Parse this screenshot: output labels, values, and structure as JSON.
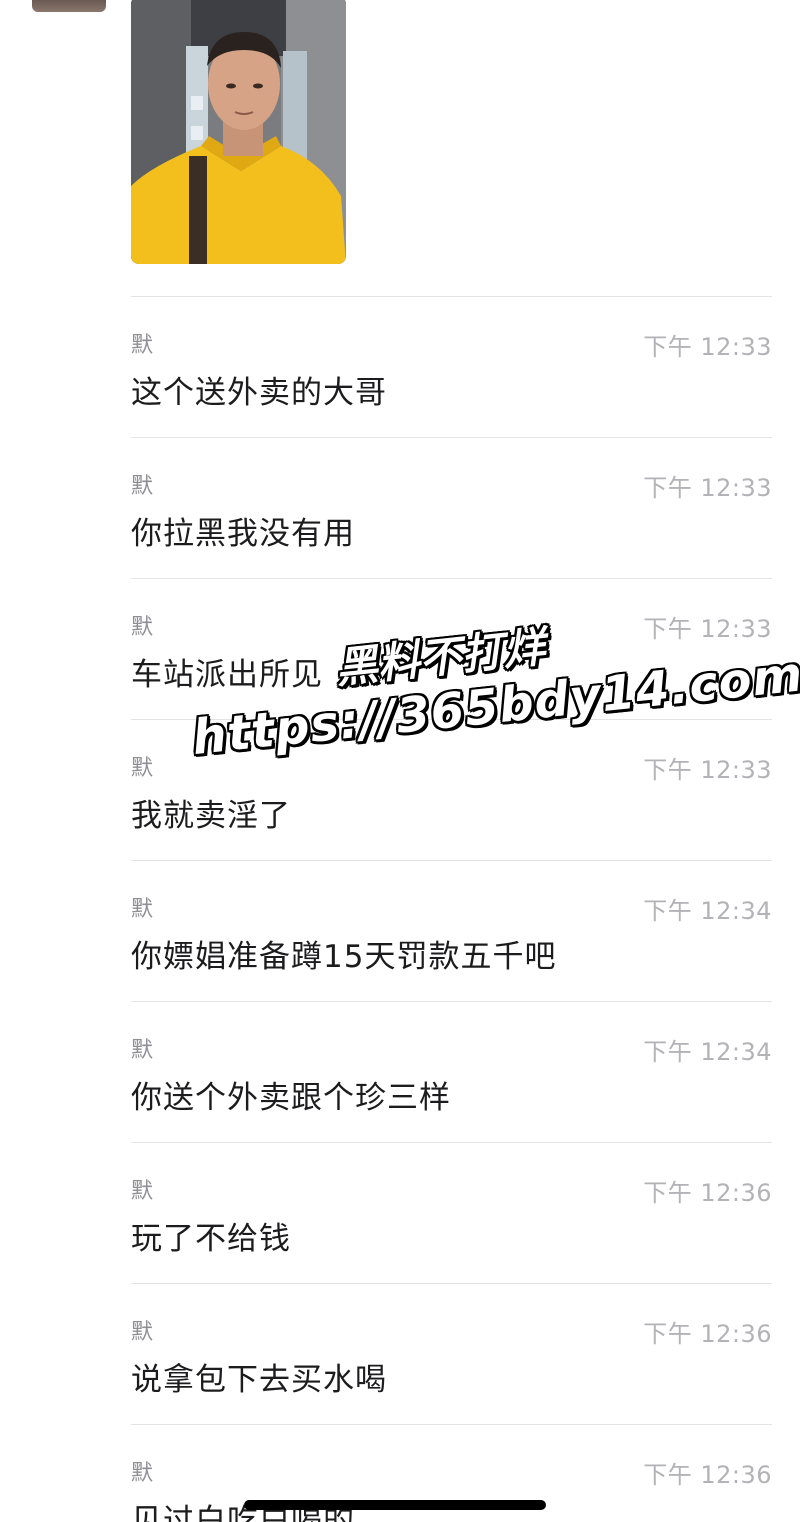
{
  "attachment": {
    "type": "photo",
    "icon": "selfie-photo"
  },
  "messages": [
    {
      "sender": "默",
      "time": "下午 12:33",
      "text": "这个送外卖的大哥"
    },
    {
      "sender": "默",
      "time": "下午 12:33",
      "text": "你拉黑我没有用"
    },
    {
      "sender": "默",
      "time": "下午 12:33",
      "text": "车站派出所见"
    },
    {
      "sender": "默",
      "time": "下午 12:33",
      "text": "我就卖淫了"
    },
    {
      "sender": "默",
      "time": "下午 12:34",
      "text": "你嫖娼准备蹲15天罚款五千吧"
    },
    {
      "sender": "默",
      "time": "下午 12:34",
      "text": "你送个外卖跟个珍三样"
    },
    {
      "sender": "默",
      "time": "下午 12:36",
      "text": "玩了不给钱"
    },
    {
      "sender": "默",
      "time": "下午 12:36",
      "text": "说拿包下去买水喝"
    },
    {
      "sender": "默",
      "time": "下午 12:36",
      "text": "见过白吃白喝的"
    }
  ],
  "watermark": {
    "line1": "黑料不打烊",
    "line2": "https://365bdy14.com"
  },
  "colors": {
    "divider": "#e4e4e6",
    "time": "#b3b3b7",
    "sender": "#8e8e93",
    "text": "#1c1c1e"
  }
}
